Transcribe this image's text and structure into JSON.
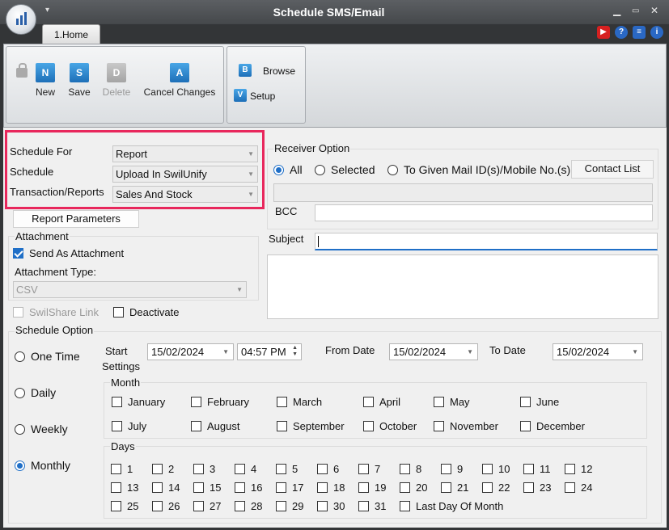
{
  "window": {
    "title": "Schedule SMS/Email"
  },
  "tabs": [
    {
      "label": "1.Home"
    }
  ],
  "ribbon": {
    "new_label": "New",
    "save_label": "Save",
    "delete_label": "Delete",
    "cancel_label": "Cancel Changes",
    "browse_label": "Browse",
    "setup_label": "Setup"
  },
  "form": {
    "schedule_for_label": "Schedule For",
    "schedule_for_value": "Report",
    "schedule_label": "Schedule",
    "schedule_value": "Upload In SwilUnify",
    "transaction_label": "Transaction/Reports",
    "transaction_value": "Sales And Stock",
    "report_parameters_label": "Report Parameters",
    "attachment_label": "Attachment",
    "send_as_attachment_label": "Send As Attachment",
    "send_as_attachment_checked": true,
    "attachment_type_label": "Attachment Type:",
    "attachment_type_value": "CSV",
    "swilshare_link_label": "SwilShare Link",
    "deactivate_label": "Deactivate"
  },
  "receiver": {
    "title": "Receiver Option",
    "all_label": "All",
    "selected_label": "Selected",
    "given_label": "To Given Mail ID(s)/Mobile No.(s)",
    "contact_list_label": "Contact List",
    "bcc_label": "BCC",
    "subject_label": "Subject"
  },
  "schedule_option": {
    "title": "Schedule Option",
    "one_time": "One Time",
    "daily": "Daily",
    "weekly": "Weekly",
    "monthly": "Monthly",
    "selected": "Monthly",
    "start_label": "Start",
    "start_date": "15/02/2024",
    "start_time": "04:57 PM",
    "from_date_label": "From Date",
    "from_date": "15/02/2024",
    "to_date_label": "To Date",
    "to_date": "15/02/2024",
    "settings_label": "Settings",
    "month_label": "Month",
    "days_label": "Days",
    "months": [
      "January",
      "February",
      "March",
      "April",
      "May",
      "June",
      "July",
      "August",
      "September",
      "October",
      "November",
      "December"
    ],
    "days": [
      "1",
      "2",
      "3",
      "4",
      "5",
      "6",
      "7",
      "8",
      "9",
      "10",
      "11",
      "12",
      "13",
      "14",
      "15",
      "16",
      "17",
      "18",
      "19",
      "20",
      "21",
      "22",
      "23",
      "24",
      "25",
      "26",
      "27",
      "28",
      "29",
      "30",
      "31"
    ],
    "last_day_label": "Last Day Of Month"
  },
  "colors": {
    "accent": "#1f6fc7",
    "highlight": "#e8275c"
  }
}
